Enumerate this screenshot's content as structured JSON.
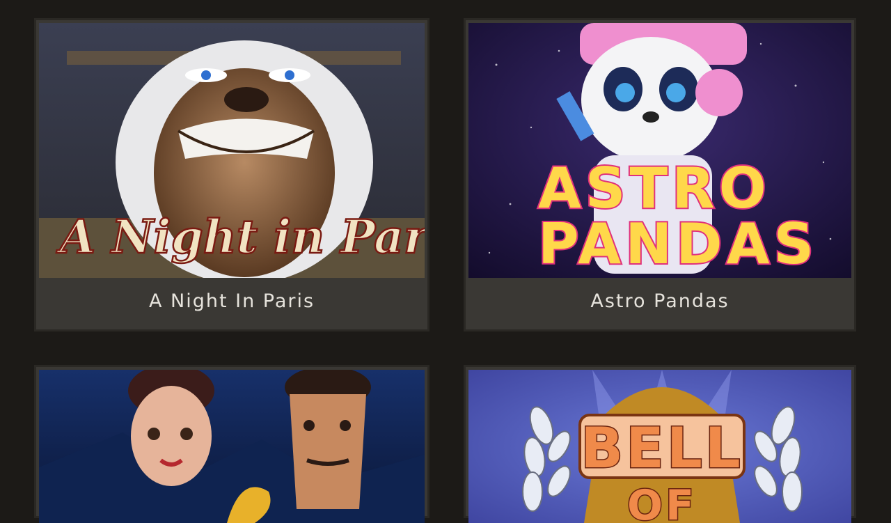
{
  "games": [
    {
      "title": "A Night In Paris",
      "logo": "A Night in Paris"
    },
    {
      "title": "Astro Pandas",
      "logo_line1": "ASTRO",
      "logo_line2": "PANDAS"
    },
    {
      "title": "",
      "logo": ""
    },
    {
      "title": "",
      "logo_line1": "BELL",
      "logo_line2": "OF"
    }
  ],
  "icons": {
    "game1": "bulldog-thumbnail",
    "game2": "panda-astronaut-thumbnail",
    "game3": "couple-characters-thumbnail",
    "game4": "bell-laurel-thumbnail"
  }
}
